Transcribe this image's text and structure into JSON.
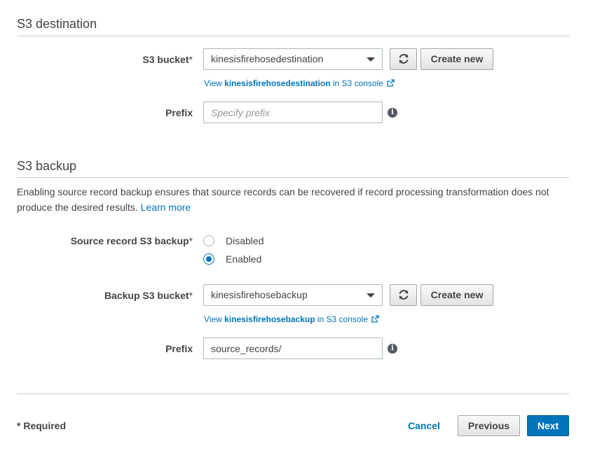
{
  "destination": {
    "title": "S3 destination",
    "bucket_label": "S3 bucket",
    "required_mark": "*",
    "bucket_value": "kinesisfirehosedestination",
    "create_new": "Create new",
    "console_link": {
      "prefix": "View",
      "bucket": "kinesisfirehosedestination",
      "suffix": "in S3 console"
    },
    "prefix_label": "Prefix",
    "prefix_placeholder": "Specify prefix",
    "prefix_value": ""
  },
  "backup": {
    "title": "S3 backup",
    "description": "Enabling source record backup ensures that source records can be recovered if record processing transformation does not produce the desired results.",
    "learn_more": "Learn more",
    "source_label": "Source record S3 backup",
    "required_mark": "*",
    "options": [
      {
        "label": "Disabled",
        "checked": false
      },
      {
        "label": "Enabled",
        "checked": true
      }
    ],
    "bucket_label": "Backup S3 bucket",
    "bucket_value": "kinesisfirehosebackup",
    "create_new": "Create new",
    "console_link": {
      "prefix": "View",
      "bucket": "kinesisfirehosebackup",
      "suffix": "in S3 console"
    },
    "prefix_label": "Prefix",
    "prefix_value": "source_records/"
  },
  "footer": {
    "required_note": "* Required",
    "cancel": "Cancel",
    "previous": "Previous",
    "next": "Next"
  },
  "icons": {
    "refresh": "refresh-icon",
    "info": "info-icon",
    "external_link": "external-link-icon",
    "dropdown": "chevron-down-icon"
  },
  "colors": {
    "accent": "#0073bb",
    "text": "#444444",
    "border": "#aab7b8"
  }
}
